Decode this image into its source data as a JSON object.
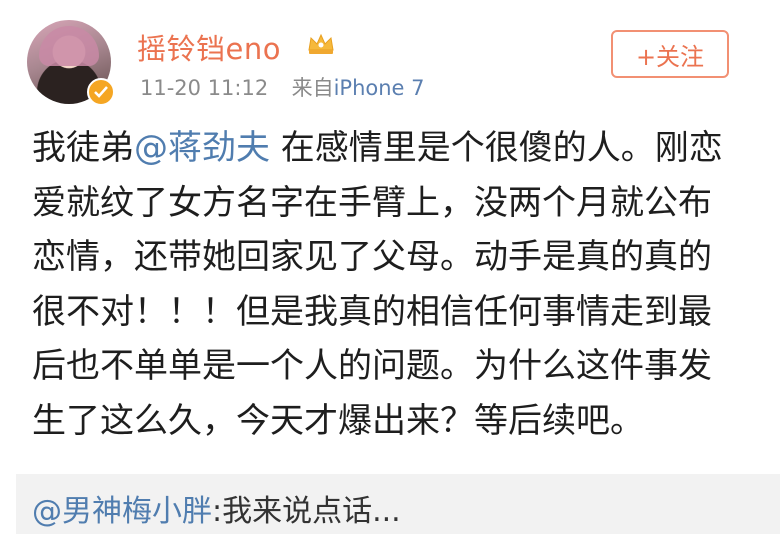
{
  "user": {
    "name": "摇铃铛eno",
    "avatar_icon": "user-avatar",
    "badge_icon": "verified-badge-icon",
    "crown_icon": "crown-icon"
  },
  "meta": {
    "time": "11-20 11:12",
    "source_prefix": "来自",
    "device": "iPhone 7"
  },
  "follow_button": {
    "label": "+关注"
  },
  "post": {
    "part1": "我徒弟",
    "mention": "@蒋劲夫",
    "part2": " 在感情里是个很傻的人。刚恋爱就纹了女方名字在手臂上，没两个月就公布恋情，还带她回家见了父母。动手是真的真的很不对！！！但是我真的相信任何事情走到最后也不单单是一个人的问题。为什么这件事发生了这么久，今天才爆出来？等后续吧。"
  },
  "repost": {
    "mention": "@男神梅小胖",
    "text": ":我来说点话..."
  },
  "colors": {
    "accent": "#eb7350",
    "link": "#507daf",
    "meta": "#8a8a8a"
  }
}
